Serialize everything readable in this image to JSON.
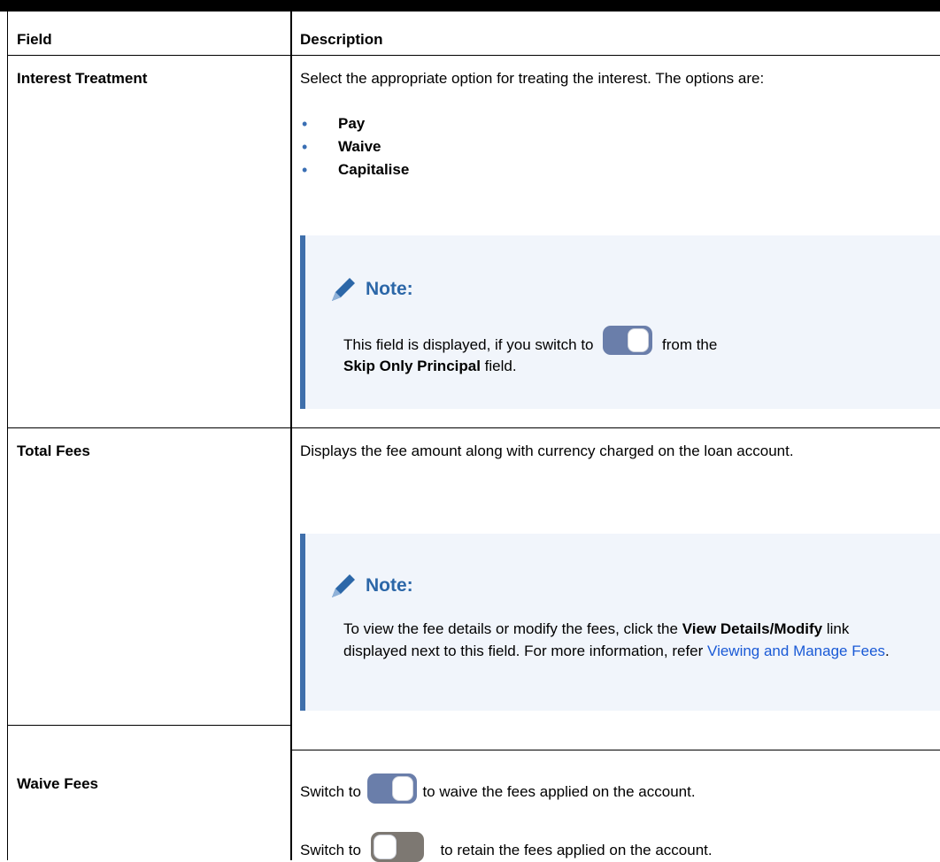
{
  "table": {
    "header": {
      "field": "Field",
      "description": "Description"
    },
    "rows": {
      "interest": {
        "field": "Interest Treatment",
        "desc_intro": "Select the appropriate option for treating the interest. The options are:",
        "options": [
          "Pay",
          "Waive",
          "Capitalise"
        ],
        "note": {
          "title": "Note:",
          "text_before": "This field is displayed, if you switch to",
          "text_after": "from the",
          "bold": "Skip Only Principal",
          "text_end": "field."
        }
      },
      "total_fees": {
        "field": "Total Fees",
        "desc": "Displays the fee amount along with currency charged on the loan account.",
        "note": {
          "title": "Note:",
          "text_before": "To view the fee details or modify the fees, click the",
          "bold": "View Details/Modify",
          "text_mid": "link displayed next to this field. For more information, refer",
          "link": "Viewing and Manage Fees",
          "text_end": "."
        }
      },
      "waive_fees": {
        "field": "Waive Fees",
        "line1_before": "Switch to",
        "line1_after": "to waive the fees applied on the account.",
        "line2_before": "Switch to",
        "line2_after": "to retain the fees applied on the account."
      }
    }
  },
  "colors": {
    "note_background": "#f1f5fb",
    "note_border": "#3f6fab",
    "note_title": "#2c67a8",
    "link": "#1a5ad6",
    "bullet": "#3a6fb4",
    "toggle_on": "#6a7eaa",
    "toggle_off": "#7d7872"
  },
  "icons": {
    "note": "pencil-icon",
    "toggle_on": "toggle-on-icon",
    "toggle_off": "toggle-off-icon"
  }
}
